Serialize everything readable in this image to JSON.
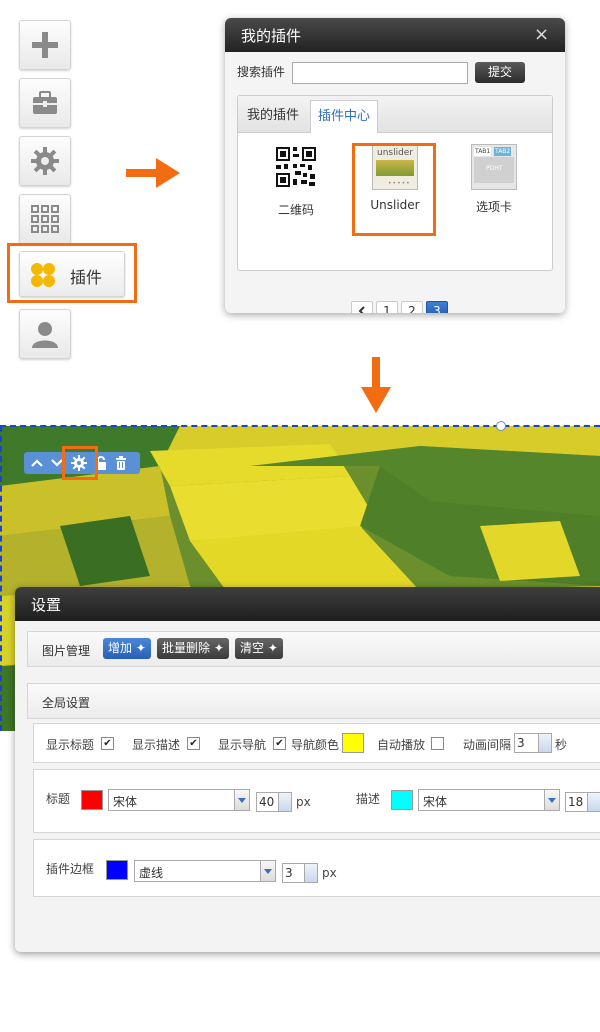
{
  "toolbar": {
    "plugin_label": "插件"
  },
  "plugin_dialog": {
    "title": "我的插件",
    "close_icon": "×",
    "search_label": "搜索插件",
    "search_value": "",
    "submit_label": "提交",
    "tabs": [
      "我的插件",
      "插件中心"
    ],
    "active_tab": "插件中心",
    "plugins": [
      {
        "name": "二维码",
        "icon": "qrcode-icon"
      },
      {
        "name": "Unslider",
        "icon": "unslider-icon",
        "thumb_text": "unslider"
      },
      {
        "name": "选项卡",
        "icon": "tabs-icon",
        "thumb_tabs": [
          "TAB1",
          "TAB2"
        ],
        "thumb_text": "PDHT"
      }
    ],
    "pagination": {
      "prev": "<",
      "pages": [
        "1",
        "2",
        "3"
      ],
      "current": "3"
    }
  },
  "field_toolbar": {
    "icons": [
      "up-icon",
      "down-icon",
      "gear-icon",
      "lock-icon",
      "trash-icon"
    ]
  },
  "settings": {
    "title": "设置",
    "image_manage_label": "图片管理",
    "buttons": {
      "add": "增加",
      "batch_delete": "批量删除",
      "clear": "清空"
    },
    "global_label": "全局设置",
    "options": {
      "show_title": "显示标题",
      "show_desc": "显示描述",
      "show_nav": "显示导航",
      "nav_color": "导航颜色",
      "autoplay": "自动播放",
      "interval_label": "动画间隔",
      "interval_value": "3",
      "interval_unit": "秒"
    },
    "title_row": {
      "title_label": "标题",
      "title_font": "宋体",
      "title_size": "40",
      "unit": "px",
      "desc_label": "描述",
      "desc_font": "宋体",
      "desc_size": "18"
    },
    "border_row": {
      "label": "插件边框",
      "style": "虚线",
      "width": "3",
      "unit": "px"
    }
  },
  "colors": {
    "accent": "#f26d12",
    "nav_color": "#ffff00",
    "title_color": "#ff0000",
    "desc_color": "#00ffff",
    "border_color": "#0000ff",
    "primary_blue": "#2f6fc6"
  }
}
